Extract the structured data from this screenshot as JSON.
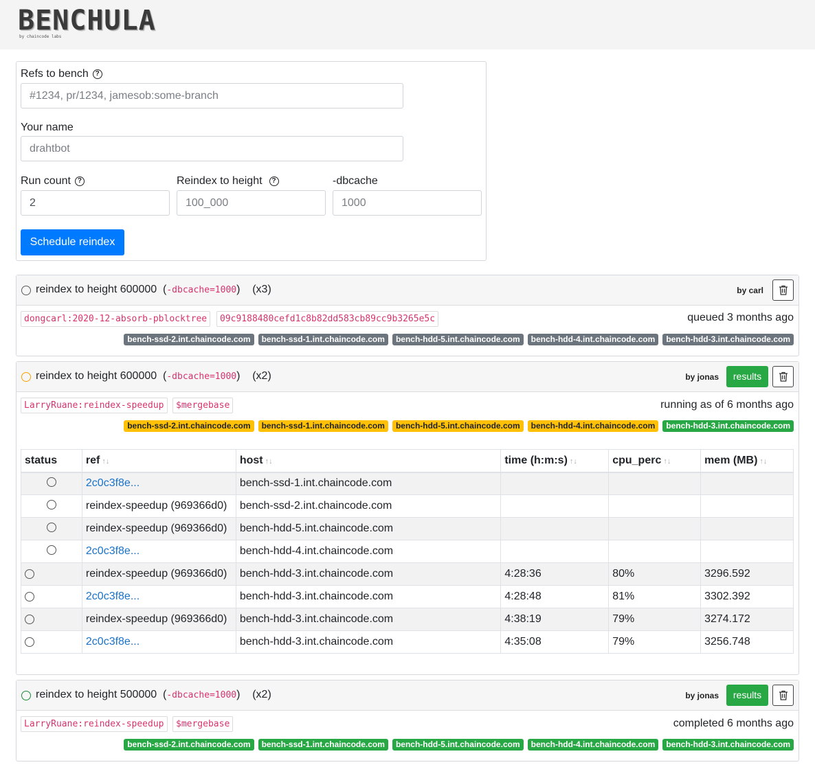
{
  "brand": {
    "name": "BENCHULA",
    "subtitle": "by chaincode labs"
  },
  "form": {
    "refs_label": "Refs to bench",
    "refs_placeholder": "#1234, pr/1234, jamesob:some-branch",
    "name_label": "Your name",
    "name_placeholder": "drahtbot",
    "run_count_label": "Run count",
    "run_count_value": "2",
    "height_label": "Reindex to height",
    "height_placeholder": "100_000",
    "dbcache_label": "-dbcache",
    "dbcache_placeholder": "1000",
    "submit_label": "Schedule reindex"
  },
  "jobs": [
    {
      "status": "queued",
      "title": "reindex to height 600000",
      "dbcache": "-dbcache=1000",
      "count": "(x3)",
      "by": "by carl",
      "refs": [
        "dongcarl:2020-12-absorb-pblocktree",
        "09c9188480cefd1c8b82dd583cb89cc9b3265e5c"
      ],
      "state": "queued 3 months ago",
      "hosts": [
        "bench-ssd-2.int.chaincode.com",
        "bench-ssd-1.int.chaincode.com",
        "bench-hdd-5.int.chaincode.com",
        "bench-hdd-4.int.chaincode.com",
        "bench-hdd-3.int.chaincode.com"
      ],
      "host_colors": [
        "gray",
        "gray",
        "gray",
        "gray",
        "gray"
      ]
    },
    {
      "status": "running",
      "title": "reindex to height 600000",
      "dbcache": "-dbcache=1000",
      "count": "(x2)",
      "by": "by jonas",
      "results_label": "results",
      "refs": [
        "LarryRuane:reindex-speedup",
        "$mergebase"
      ],
      "state": "running as of 6 months ago",
      "hosts": [
        "bench-ssd-2.int.chaincode.com",
        "bench-ssd-1.int.chaincode.com",
        "bench-hdd-5.int.chaincode.com",
        "bench-hdd-4.int.chaincode.com",
        "bench-hdd-3.int.chaincode.com"
      ],
      "host_colors": [
        "yellow",
        "yellow",
        "yellow",
        "yellow",
        "green"
      ],
      "table": {
        "columns": [
          "status",
          "ref",
          "host",
          "time (h:m:s)",
          "cpu_perc",
          "mem (MB)"
        ],
        "sort_glyph": "↑↓",
        "rows": [
          {
            "status": "running",
            "ref": "2c0c3f8e...",
            "ref_link": true,
            "host": "bench-ssd-1.int.chaincode.com",
            "time": "",
            "cpu": "",
            "mem": ""
          },
          {
            "status": "running",
            "ref": "reindex-speedup (969366d0)",
            "ref_link": false,
            "host": "bench-ssd-2.int.chaincode.com",
            "time": "",
            "cpu": "",
            "mem": ""
          },
          {
            "status": "running",
            "ref": "reindex-speedup (969366d0)",
            "ref_link": false,
            "host": "bench-hdd-5.int.chaincode.com",
            "time": "",
            "cpu": "",
            "mem": ""
          },
          {
            "status": "running",
            "ref": "2c0c3f8e...",
            "ref_link": true,
            "host": "bench-hdd-4.int.chaincode.com",
            "time": "",
            "cpu": "",
            "mem": ""
          },
          {
            "status": "done",
            "ref": "reindex-speedup (969366d0)",
            "ref_link": false,
            "host": "bench-hdd-3.int.chaincode.com",
            "time": "4:28:36",
            "cpu": "80%",
            "mem": "3296.592"
          },
          {
            "status": "done",
            "ref": "2c0c3f8e...",
            "ref_link": true,
            "host": "bench-hdd-3.int.chaincode.com",
            "time": "4:28:48",
            "cpu": "81%",
            "mem": "3302.392"
          },
          {
            "status": "done",
            "ref": "reindex-speedup (969366d0)",
            "ref_link": false,
            "host": "bench-hdd-3.int.chaincode.com",
            "time": "4:38:19",
            "cpu": "79%",
            "mem": "3274.172"
          },
          {
            "status": "done",
            "ref": "2c0c3f8e...",
            "ref_link": true,
            "host": "bench-hdd-3.int.chaincode.com",
            "time": "4:35:08",
            "cpu": "79%",
            "mem": "3256.748"
          }
        ]
      }
    },
    {
      "status": "completed",
      "title": "reindex to height 500000",
      "dbcache": "-dbcache=1000",
      "count": "(x2)",
      "by": "by jonas",
      "results_label": "results",
      "refs": [
        "LarryRuane:reindex-speedup",
        "$mergebase"
      ],
      "state": "completed 6 months ago",
      "hosts": [
        "bench-ssd-2.int.chaincode.com",
        "bench-ssd-1.int.chaincode.com",
        "bench-hdd-5.int.chaincode.com",
        "bench-hdd-4.int.chaincode.com",
        "bench-hdd-3.int.chaincode.com"
      ],
      "host_colors": [
        "green",
        "green",
        "green",
        "green",
        "green"
      ]
    }
  ],
  "colors": {
    "primary": "#007bff",
    "success": "#28a745",
    "warning": "#ffc107",
    "secondary": "#6c757d",
    "code": "#d6336c"
  }
}
